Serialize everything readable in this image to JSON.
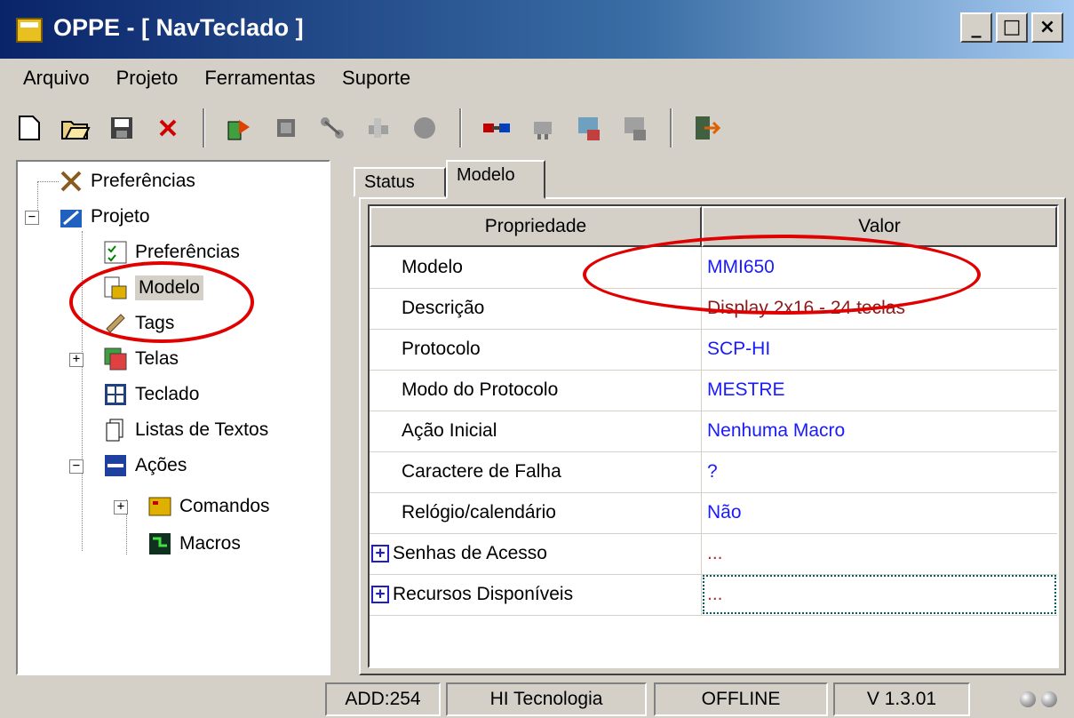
{
  "window": {
    "title": "OPPE - [ NavTeclado ]",
    "minimize": "_",
    "maximize": "□",
    "close": "×"
  },
  "menu": [
    "Arquivo",
    "Projeto",
    "Ferramentas",
    "Suporte"
  ],
  "toolbar_icons": [
    "new-file-icon",
    "open-folder-icon",
    "save-icon",
    "delete-icon",
    "import-icon",
    "chip-icon",
    "network-icon",
    "tools-icon",
    "circle-icon",
    "connect-icon",
    "plug-icon",
    "download-icon",
    "upload-icon",
    "exit-icon"
  ],
  "tree": {
    "root_pref": "Preferências",
    "projeto": "Projeto",
    "preferencias": "Preferências",
    "modelo": "Modelo",
    "tags": "Tags",
    "telas": "Telas",
    "teclado": "Teclado",
    "listas": "Listas de Textos",
    "acoes": "Ações",
    "comandos": "Comandos",
    "macros": "Macros"
  },
  "tabs": {
    "status": "Status",
    "modelo": "Modelo"
  },
  "grid": {
    "col1": "Propriedade",
    "col2": "Valor",
    "rows": [
      {
        "prop": "Modelo",
        "value": "MMI650"
      },
      {
        "prop": "Descrição",
        "value": "Display 2x16 - 24 teclas"
      },
      {
        "prop": "Protocolo",
        "value": "SCP-HI"
      },
      {
        "prop": "Modo do Protocolo",
        "value": "MESTRE"
      },
      {
        "prop": "Ação Inicial",
        "value": "Nenhuma Macro"
      },
      {
        "prop": "Caractere de Falha",
        "value": "?"
      },
      {
        "prop": "Relógio/calendário",
        "value": "Não"
      },
      {
        "prop": "Senhas de Acesso",
        "value": "..."
      },
      {
        "prop": "Recursos Disponíveis",
        "value": "..."
      }
    ]
  },
  "status": {
    "add": "ADD:254",
    "company": "HI Tecnologia",
    "state": "OFFLINE",
    "version": "V 1.3.01"
  }
}
